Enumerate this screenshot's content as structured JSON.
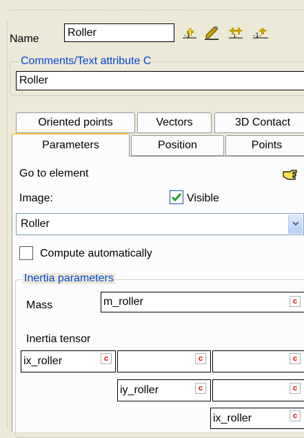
{
  "header": {
    "name_label": "Name",
    "name_value": "Roller",
    "toolbar_icons": [
      "add-point-icon",
      "edit-icon",
      "add-multiple-icon",
      "add-scale-icon"
    ]
  },
  "comments": {
    "legend": "Comments/Text attribute C",
    "value": "Roller"
  },
  "tabs": {
    "row_back": [
      "Oriented points",
      "Vectors",
      "3D Contact"
    ],
    "row_front": [
      "Parameters",
      "Position",
      "Points"
    ],
    "active": "Parameters"
  },
  "parameters": {
    "goto_label": "Go to element",
    "image_label": "Image:",
    "visible_label": "Visible",
    "visible_checked": true,
    "image_select_value": "Roller",
    "compute_label": "Compute automatically",
    "compute_checked": false
  },
  "inertia": {
    "legend": "Inertia parameters",
    "mass_label": "Mass",
    "mass_value": "m_roller",
    "tensor_label": "Inertia tensor",
    "c_marker": "c",
    "tensor": {
      "ixx": "ix_roller",
      "ixy": "",
      "ixz": "",
      "iyy": "iy_roller",
      "iyz": "",
      "izz": "ix_roller"
    }
  }
}
